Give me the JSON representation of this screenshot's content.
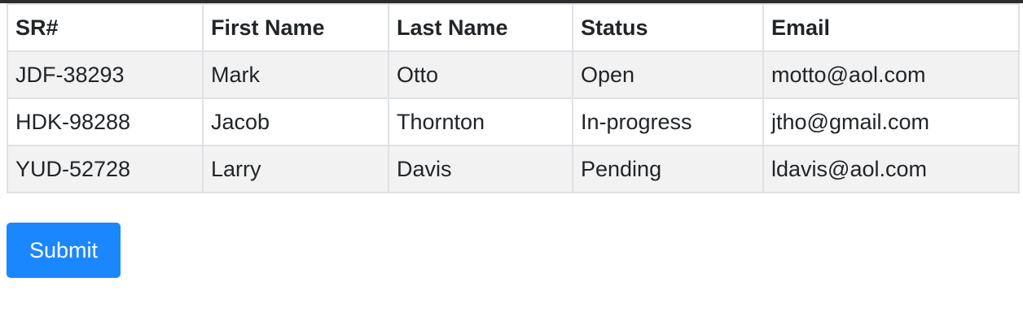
{
  "table": {
    "headers": [
      "SR#",
      "First Name",
      "Last Name",
      "Status",
      "Email"
    ],
    "rows": [
      [
        "JDF-38293",
        "Mark",
        "Otto",
        "Open",
        "motto@aol.com"
      ],
      [
        "HDK-98288",
        "Jacob",
        "Thornton",
        "In-progress",
        "jtho@gmail.com"
      ],
      [
        "YUD-52728",
        "Larry",
        "Davis",
        "Pending",
        "ldavis@aol.com"
      ]
    ]
  },
  "form": {
    "submit_label": "Submit"
  },
  "colors": {
    "accent": "#1b87ff",
    "stripe": "#f2f2f2",
    "border": "#dee2e6",
    "top_bar": "#2d2d2d"
  }
}
